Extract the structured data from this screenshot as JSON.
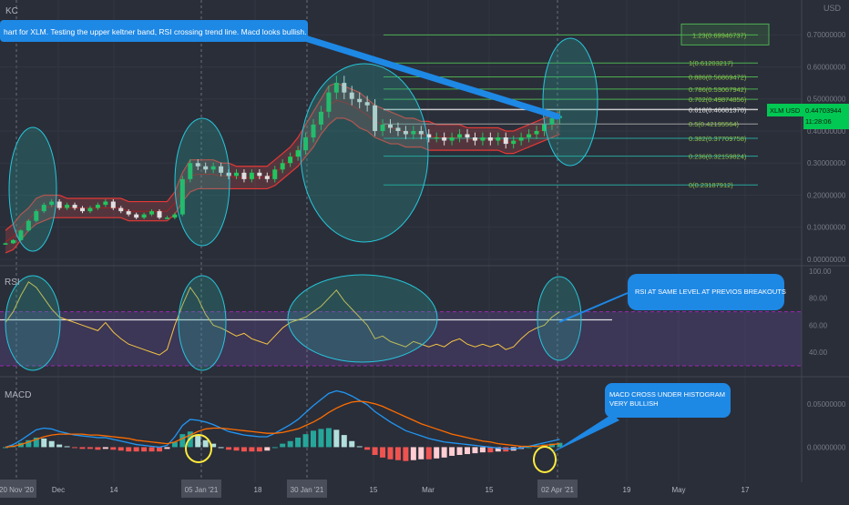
{
  "app": {
    "symbol_short": "KC",
    "currency": "USD",
    "background": "#2a2e39",
    "accent_up": "#26a69a",
    "accent_green": "#22c55e",
    "accent_red": "#ef5350"
  },
  "annotations": {
    "top_note": "hart for XLM.  Testing the upper keltner band, RSI crossing trend line.  Macd looks bullish.",
    "rsi_note": "RSI AT SAME LEVEL AT PREVIOS BREAKOUTS",
    "macd_note_line1": "MACD CROSS UNDER HISTOGRAM",
    "macd_note_line2": "VERY BULLISH"
  },
  "price_badge": {
    "label": "XLM USD",
    "value": "0.44703944",
    "sub": "11:28:06"
  },
  "chart_data": [
    {
      "type": "line",
      "name": "price",
      "title": "",
      "ylabel": "USD",
      "y_axis_ticks": [
        "0.70000000",
        "0.60000000",
        "0.50000000",
        "0.40000000",
        "0.30000000",
        "0.20000000",
        "0.10000000",
        "0.00000000"
      ],
      "ylim": [
        0,
        0.78
      ],
      "x_labels": [
        "20 Nov '20",
        "Dec",
        "14",
        "05 Jan '21",
        "18",
        "30 Jan '21",
        "15",
        "Mar",
        "15",
        "02 Apr '21",
        "19",
        "May",
        "17"
      ],
      "close_series": [
        0.05,
        0.06,
        0.09,
        0.12,
        0.15,
        0.17,
        0.18,
        0.16,
        0.17,
        0.16,
        0.15,
        0.16,
        0.17,
        0.18,
        0.16,
        0.15,
        0.14,
        0.13,
        0.14,
        0.15,
        0.13,
        0.13,
        0.14,
        0.25,
        0.3,
        0.29,
        0.28,
        0.29,
        0.27,
        0.26,
        0.27,
        0.25,
        0.27,
        0.26,
        0.25,
        0.28,
        0.3,
        0.32,
        0.34,
        0.38,
        0.42,
        0.46,
        0.52,
        0.55,
        0.52,
        0.5,
        0.49,
        0.48,
        0.4,
        0.42,
        0.41,
        0.4,
        0.39,
        0.4,
        0.39,
        0.38,
        0.38,
        0.37,
        0.38,
        0.39,
        0.38,
        0.37,
        0.38,
        0.37,
        0.38,
        0.36,
        0.37,
        0.38,
        0.39,
        0.4,
        0.42,
        0.44,
        0.447
      ],
      "keltner_upper": [
        0.09,
        0.11,
        0.14,
        0.16,
        0.19,
        0.2,
        0.2,
        0.2,
        0.19,
        0.19,
        0.19,
        0.19,
        0.19,
        0.19,
        0.19,
        0.19,
        0.18,
        0.18,
        0.18,
        0.18,
        0.18,
        0.18,
        0.21,
        0.27,
        0.31,
        0.31,
        0.31,
        0.31,
        0.3,
        0.3,
        0.29,
        0.29,
        0.29,
        0.29,
        0.29,
        0.31,
        0.33,
        0.35,
        0.38,
        0.42,
        0.46,
        0.5,
        0.54,
        0.55,
        0.54,
        0.53,
        0.52,
        0.5,
        0.48,
        0.47,
        0.46,
        0.45,
        0.44,
        0.44,
        0.43,
        0.43,
        0.42,
        0.42,
        0.42,
        0.42,
        0.41,
        0.41,
        0.41,
        0.41,
        0.41,
        0.4,
        0.4,
        0.41,
        0.42,
        0.43,
        0.44,
        0.45,
        0.46
      ],
      "keltner_lower": [
        0.02,
        0.03,
        0.06,
        0.09,
        0.11,
        0.12,
        0.13,
        0.13,
        0.13,
        0.13,
        0.13,
        0.13,
        0.13,
        0.13,
        0.13,
        0.13,
        0.12,
        0.12,
        0.12,
        0.12,
        0.12,
        0.12,
        0.14,
        0.18,
        0.21,
        0.22,
        0.22,
        0.22,
        0.22,
        0.22,
        0.22,
        0.22,
        0.22,
        0.22,
        0.22,
        0.23,
        0.25,
        0.27,
        0.29,
        0.32,
        0.35,
        0.39,
        0.42,
        0.44,
        0.44,
        0.43,
        0.41,
        0.4,
        0.38,
        0.37,
        0.36,
        0.36,
        0.35,
        0.35,
        0.35,
        0.34,
        0.34,
        0.34,
        0.34,
        0.34,
        0.34,
        0.34,
        0.34,
        0.34,
        0.34,
        0.33,
        0.33,
        0.34,
        0.35,
        0.36,
        0.37,
        0.38,
        0.39
      ],
      "fib_levels": [
        {
          "label": "1.23(0.69946737)",
          "value": 0.6995
        },
        {
          "label": "1(0.61203217)",
          "value": 0.612
        },
        {
          "label": "0.886(0.56869472)",
          "value": 0.5687
        },
        {
          "label": "0.786(0.53067942)",
          "value": 0.5307
        },
        {
          "label": "0.702(0.49874856)",
          "value": 0.4987
        },
        {
          "label": "0.618(0.46681370)",
          "value": 0.4668
        },
        {
          "label": "0.5(0.42195564)",
          "value": 0.422
        },
        {
          "label": "0.382(0.37709758)",
          "value": 0.3771
        },
        {
          "label": "0.236(0.32159824)",
          "value": 0.3216
        },
        {
          "label": "0(0.23187912)",
          "value": 0.2319
        }
      ]
    },
    {
      "type": "line",
      "name": "RSI",
      "title": "RSI",
      "y_axis_ticks": [
        "100.00",
        "80.00",
        "60.00",
        "40.00"
      ],
      "ylim": [
        30,
        100
      ],
      "upper_band": 70,
      "lower_band": 30,
      "trend_line": 64,
      "values": [
        62,
        70,
        82,
        92,
        88,
        80,
        72,
        66,
        64,
        62,
        60,
        58,
        56,
        62,
        55,
        50,
        46,
        44,
        42,
        40,
        38,
        42,
        60,
        75,
        88,
        80,
        68,
        60,
        58,
        55,
        52,
        54,
        50,
        48,
        46,
        52,
        58,
        62,
        64,
        66,
        70,
        74,
        80,
        86,
        78,
        72,
        66,
        60,
        50,
        52,
        48,
        46,
        44,
        48,
        46,
        44,
        46,
        44,
        48,
        50,
        46,
        44,
        46,
        44,
        46,
        42,
        44,
        50,
        55,
        58,
        60,
        66,
        70
      ]
    },
    {
      "type": "bar",
      "name": "MACD",
      "title": "MACD",
      "y_axis_ticks": [
        "0.05000000",
        "0.00000000"
      ],
      "ylim": [
        -0.03,
        0.075
      ],
      "macd": [
        0.0,
        0.003,
        0.008,
        0.014,
        0.02,
        0.022,
        0.021,
        0.018,
        0.016,
        0.014,
        0.013,
        0.012,
        0.011,
        0.011,
        0.009,
        0.007,
        0.005,
        0.003,
        0.002,
        0.001,
        0.0,
        0.002,
        0.012,
        0.025,
        0.032,
        0.031,
        0.029,
        0.026,
        0.022,
        0.018,
        0.016,
        0.014,
        0.013,
        0.012,
        0.012,
        0.016,
        0.021,
        0.026,
        0.032,
        0.04,
        0.048,
        0.055,
        0.062,
        0.065,
        0.063,
        0.059,
        0.054,
        0.049,
        0.041,
        0.035,
        0.029,
        0.024,
        0.019,
        0.016,
        0.013,
        0.01,
        0.008,
        0.006,
        0.005,
        0.004,
        0.003,
        0.002,
        0.001,
        0.0,
        -0.001,
        -0.002,
        -0.002,
        -0.001,
        0.001,
        0.003,
        0.005,
        0.007,
        0.009
      ],
      "signal": [
        0.0,
        0.001,
        0.003,
        0.006,
        0.009,
        0.012,
        0.014,
        0.015,
        0.015,
        0.015,
        0.015,
        0.014,
        0.014,
        0.013,
        0.012,
        0.011,
        0.01,
        0.008,
        0.007,
        0.006,
        0.005,
        0.004,
        0.006,
        0.01,
        0.014,
        0.018,
        0.021,
        0.022,
        0.022,
        0.021,
        0.02,
        0.019,
        0.018,
        0.017,
        0.016,
        0.016,
        0.017,
        0.019,
        0.021,
        0.025,
        0.029,
        0.034,
        0.04,
        0.045,
        0.049,
        0.052,
        0.053,
        0.052,
        0.05,
        0.047,
        0.043,
        0.039,
        0.035,
        0.031,
        0.027,
        0.024,
        0.021,
        0.018,
        0.015,
        0.013,
        0.011,
        0.009,
        0.007,
        0.006,
        0.004,
        0.003,
        0.002,
        0.001,
        0.001,
        0.001,
        0.002,
        0.003,
        0.004
      ]
    }
  ]
}
